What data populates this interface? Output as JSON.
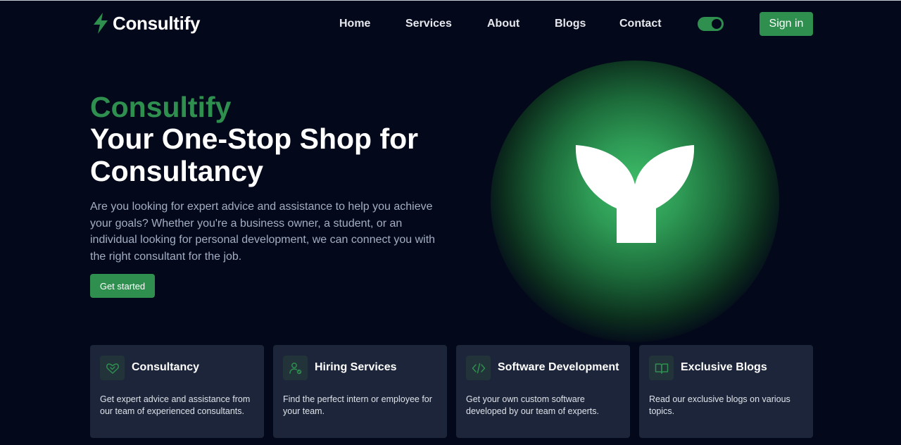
{
  "brand": {
    "name": "Consultify"
  },
  "nav": {
    "links": [
      "Home",
      "Services",
      "About",
      "Blogs",
      "Contact"
    ],
    "signin_label": "Sign in"
  },
  "hero": {
    "brand": "Consultify",
    "title": "Your One-Stop Shop for Consultancy",
    "description": "Are you looking for expert advice and assistance to help you achieve your goals? Whether you're a business owner, a student, or an individual looking for personal development, we can connect you with the right consultant for the job.",
    "cta_label": "Get started"
  },
  "cards": [
    {
      "icon": "handshake-heart-icon",
      "title": "Consultancy",
      "description": "Get expert advice and assistance from our team of experienced consultants."
    },
    {
      "icon": "user-check-icon",
      "title": "Hiring Services",
      "description": "Find the perfect intern or employee for your team."
    },
    {
      "icon": "code-icon",
      "title": "Software Development",
      "description": "Get your own custom software developed by our team of experts."
    },
    {
      "icon": "book-open-icon",
      "title": "Exclusive Blogs",
      "description": "Read our exclusive blogs on various topics."
    }
  ],
  "colors": {
    "accent": "#2e8f4f",
    "background": "#03081a",
    "card": "#1c2539",
    "text_muted": "#a3aec4"
  }
}
